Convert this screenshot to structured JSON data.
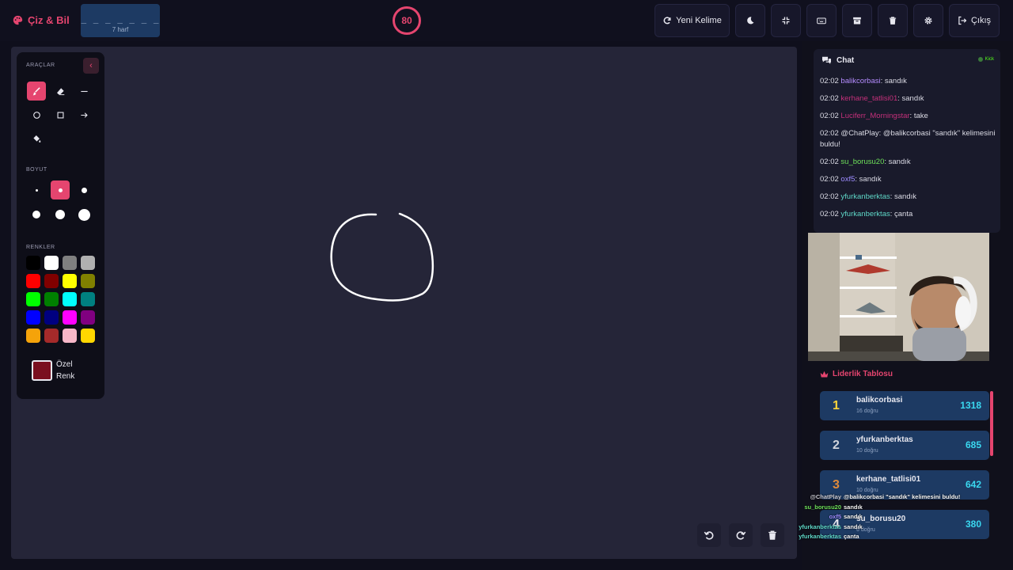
{
  "app": {
    "title": "Çiz & Bil",
    "accent": "#e5456f"
  },
  "word": {
    "dashes": "_ _ _ _ _ _ _",
    "letters": "7 harf"
  },
  "timer": {
    "value": "80"
  },
  "toolbar": {
    "new_word": "Yeni Kelime",
    "exit": "Çıkış",
    "icons": [
      "refresh-icon",
      "moon-icon",
      "compress-icon",
      "keyboard-icon",
      "archive-icon",
      "trash-icon",
      "gear-icon",
      "sign-out-icon"
    ]
  },
  "tools": {
    "section": "ARAÇLAR",
    "size_section": "BOYUT",
    "colors_section": "RENKLER",
    "custom_color_label": "Özel Renk",
    "custom_color": "#7a0f1f",
    "active_tool": "brush",
    "active_size": 2,
    "colors": [
      "#000000",
      "#ffffff",
      "#808080",
      "#b0b0b0",
      "#ff0000",
      "#800000",
      "#ffff00",
      "#808000",
      "#00ff00",
      "#008000",
      "#00ffff",
      "#008080",
      "#0000ff",
      "#000080",
      "#ff00ff",
      "#800080",
      "#f5a30a",
      "#a52a2a",
      "#f7b7c8",
      "#ffd700"
    ]
  },
  "chat": {
    "title": "Chat",
    "platform": "Kick",
    "messages": [
      {
        "time": "02:02",
        "user": "balikcorbasi",
        "color": "#b58cff",
        "text": ": sandık"
      },
      {
        "time": "02:02",
        "user": "kerhane_tatlisi01",
        "color": "#c4307a",
        "text": ": sandık"
      },
      {
        "time": "02:02",
        "user": "Luciferr_Morningstar",
        "color": "#c4307a",
        "text": ": take"
      },
      {
        "time": "02:02",
        "user": "@ChatPlay",
        "color": "#dcdce6",
        "text": ": @balikcorbasi \"sandık\" kelimesini buldu!"
      },
      {
        "time": "02:02",
        "user": "su_borusu20",
        "color": "#6ee05a",
        "text": ": sandık"
      },
      {
        "time": "02:02",
        "user": "oxf5",
        "color": "#9d8cff",
        "text": ": sandık"
      },
      {
        "time": "02:02",
        "user": "yfurkanberktas",
        "color": "#5fd8c8",
        "text": ": sandık"
      },
      {
        "time": "02:02",
        "user": "yfurkanberktas",
        "color": "#5fd8c8",
        "text": ": çanta"
      }
    ]
  },
  "leaderboard": {
    "title": "Liderlik Tablosu",
    "rows": [
      {
        "rank": "1",
        "name": "balikcorbasi",
        "correct": "16 doğru",
        "score": "1318",
        "rank_color": "#ffd43a"
      },
      {
        "rank": "2",
        "name": "yfurkanberktas",
        "correct": "10 doğru",
        "score": "685",
        "rank_color": "#d0d4dc"
      },
      {
        "rank": "3",
        "name": "kerhane_tatlisi01",
        "correct": "10 doğru",
        "score": "642",
        "rank_color": "#e08a3a"
      },
      {
        "rank": "4",
        "name": "su_borusu20",
        "correct": "6 doğru",
        "score": "380",
        "rank_color": "#e8e8f0"
      }
    ]
  },
  "overlay": [
    {
      "user": "@ChatPlay",
      "color": "#c8c8d0",
      "text": "@balikcorbasi \"sandık\" kelimesini buldu!"
    },
    {
      "user": "su_borusu20",
      "color": "#6ee05a",
      "text": "sandık"
    },
    {
      "user": "oxf5",
      "color": "#9d8cff",
      "text": "sandık"
    },
    {
      "user": "yfurkanberktas",
      "color": "#5fd8c8",
      "text": "sandık"
    },
    {
      "user": "yfurkanberktas",
      "color": "#5fd8c8",
      "text": "çanta"
    }
  ]
}
